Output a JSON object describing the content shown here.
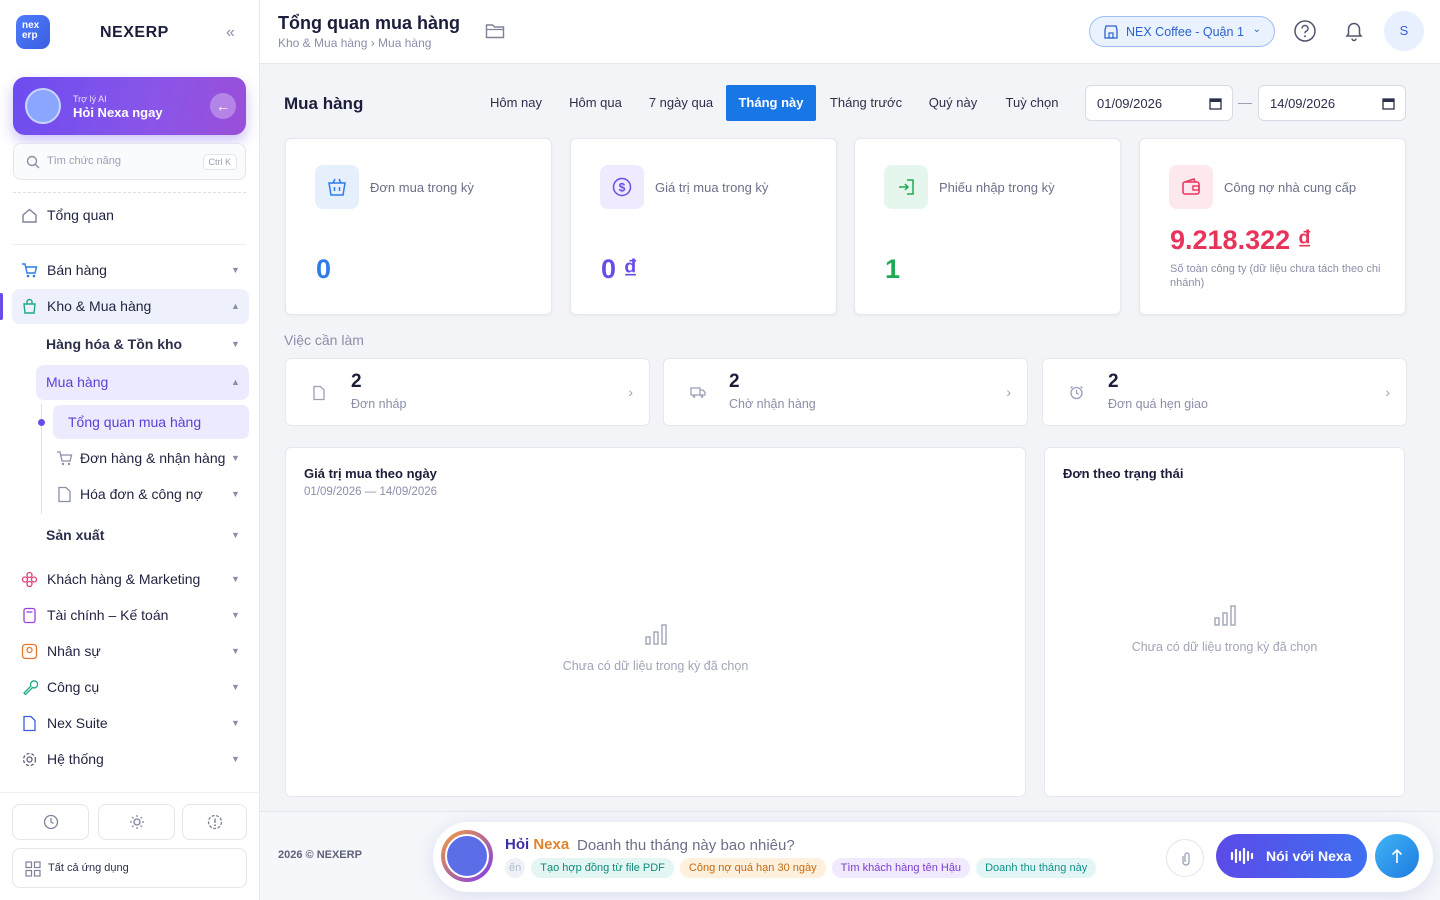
{
  "app": {
    "logo_text": "nex erp",
    "name": "NEXERP"
  },
  "ai": {
    "sub": "Trợ lý AI",
    "title": "Hỏi Nexa ngay"
  },
  "search": {
    "placeholder": "Tìm chức năng",
    "shortcut": "Ctrl K"
  },
  "sidebar": {
    "overview": "Tổng quan",
    "sales": "Bán hàng",
    "warehouse": "Kho & Mua hàng",
    "goods": "Hàng hóa & Tồn kho",
    "purchase": "Mua hàng",
    "purchase_overview": "Tổng quan mua hàng",
    "orders": "Đơn hàng & nhận hàng",
    "invoices": "Hóa đơn & công nợ",
    "production": "Sản xuất",
    "customers": "Khách hàng & Marketing",
    "finance": "Tài chính – Kế toán",
    "hr": "Nhân sự",
    "tools": "Công cụ",
    "suite": "Nex Suite",
    "system": "Hệ thống",
    "all_apps": "Tất cả ứng dụng"
  },
  "header": {
    "title": "Tổng quan mua hàng",
    "breadcrumb": "Kho & Mua hàng › Mua hàng",
    "branch": "NEX Coffee - Quận 1",
    "user_initial": "S"
  },
  "filters": {
    "section": "Mua hàng",
    "tabs": [
      "Hôm nay",
      "Hôm qua",
      "7 ngày qua",
      "Tháng này",
      "Tháng trước",
      "Quý này",
      "Tuỳ chọn"
    ],
    "active_tab": "Tháng này",
    "date_from": "01/09/2026",
    "date_to": "14/09/2026"
  },
  "kpis": [
    {
      "label": "Đơn mua trong kỳ",
      "value": "0",
      "color": "#2f7be8",
      "icon": "basket-icon"
    },
    {
      "label": "Giá trị mua trong kỳ",
      "value": "0 ₫",
      "color": "#6a4de8",
      "icon": "dollar-icon"
    },
    {
      "label": "Phiếu nhập trong kỳ",
      "value": "1",
      "color": "#1faa55",
      "icon": "import-icon"
    },
    {
      "label": "Công nợ nhà cung cấp",
      "value": "9.218.322 ₫",
      "color": "#e8335a",
      "icon": "wallet-icon",
      "note": "Số toàn công ty (dữ liệu chưa tách theo chi nhánh)"
    }
  ],
  "todo": {
    "title": "Việc cần làm",
    "items": [
      {
        "count": "2",
        "label": "Đơn nháp"
      },
      {
        "count": "2",
        "label": "Chờ nhận hàng"
      },
      {
        "count": "2",
        "label": "Đơn quá hẹn giao"
      }
    ]
  },
  "charts": {
    "daily_title": "Giá trị mua theo ngày",
    "daily_range": "01/09/2026 — 14/09/2026",
    "status_title": "Đơn theo trạng thái",
    "empty": "Chưa có dữ liệu trong kỳ đã chọn"
  },
  "footer": {
    "copyright": "2026 © NEXERP"
  },
  "chat": {
    "hoi": "Hỏi",
    "nexa": "Nexa",
    "question": "Doanh thu tháng này bao nhiêu?",
    "chips": [
      "ến",
      "Tạo hợp đồng từ file PDF",
      "Công nợ quá hạn 30 ngày",
      "Tìm khách hàng tên Hậu",
      "Doanh thu tháng này"
    ],
    "talk": "Nói với Nexa"
  }
}
